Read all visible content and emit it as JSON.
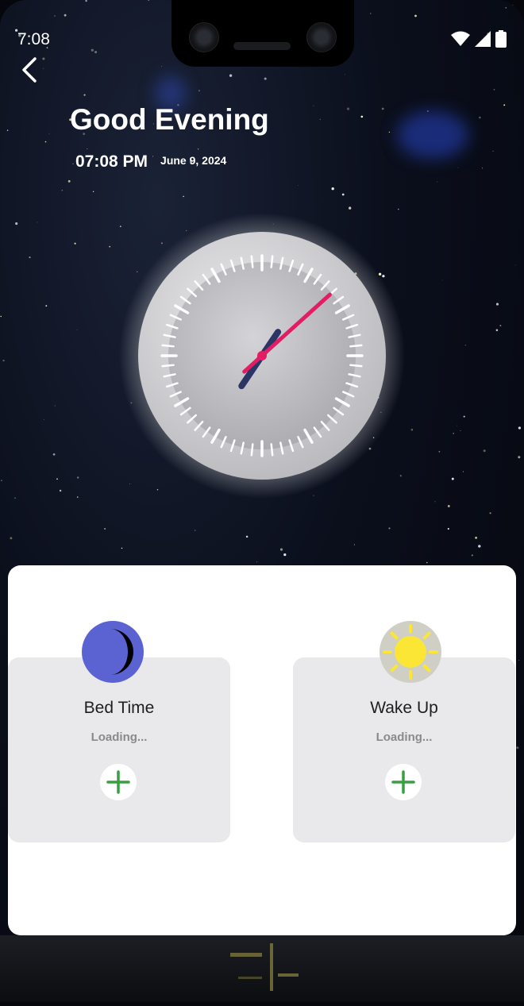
{
  "status_bar": {
    "time": "7:08"
  },
  "header": {
    "greeting": "Good Evening",
    "time": "07:08 PM",
    "date": "June 9, 2024"
  },
  "clock": {
    "hour": 7,
    "minute": 8
  },
  "schedule": {
    "bed_time": {
      "title": "Bed Time",
      "status": "Loading..."
    },
    "wake_up": {
      "title": "Wake Up",
      "status": "Loading..."
    }
  },
  "colors": {
    "moon_bg": "#5b63d3",
    "sun_bg": "#cfcfc6",
    "sun": "#fbe635",
    "plus": "#3a9e42",
    "hour_hand": "#2b3566",
    "minute_hand": "#e21d63"
  },
  "icons": {
    "back": "chevron-left-icon",
    "wifi": "wifi-icon",
    "signal": "cell-signal-icon",
    "battery": "battery-icon",
    "moon": "moon-icon",
    "sun": "sun-icon",
    "add": "plus-icon"
  }
}
